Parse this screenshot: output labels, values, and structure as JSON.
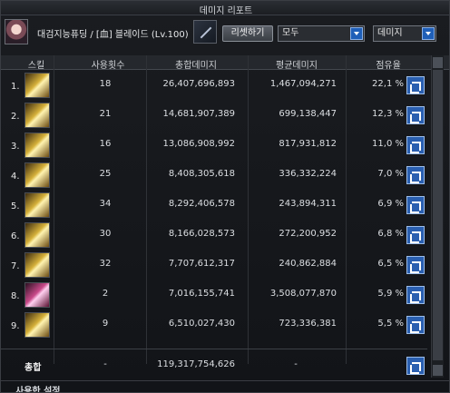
{
  "window": {
    "title": "데미지 리포트"
  },
  "header": {
    "character": "대검지능퓨딩 / [血] 블레이드 (Lv.100)",
    "reset_label": "리셋하기",
    "filter_select": "모두",
    "metric_select": "데미지"
  },
  "table": {
    "columns": [
      "스킬",
      "사용횟수",
      "총합데미지",
      "평균데미지",
      "점유율"
    ],
    "rows": [
      {
        "rank": "1.",
        "uses": "18",
        "total": "26,407,696,893",
        "avg": "1,467,094,271",
        "share": "22,1 %"
      },
      {
        "rank": "2.",
        "uses": "21",
        "total": "14,681,907,389",
        "avg": "699,138,447",
        "share": "12,3 %"
      },
      {
        "rank": "3.",
        "uses": "16",
        "total": "13,086,908,992",
        "avg": "817,931,812",
        "share": "11,0 %"
      },
      {
        "rank": "4.",
        "uses": "25",
        "total": "8,408,305,618",
        "avg": "336,332,224",
        "share": "7,0 %"
      },
      {
        "rank": "5.",
        "uses": "34",
        "total": "8,292,406,578",
        "avg": "243,894,311",
        "share": "6,9 %"
      },
      {
        "rank": "6.",
        "uses": "30",
        "total": "8,166,028,573",
        "avg": "272,200,952",
        "share": "6,8 %"
      },
      {
        "rank": "7.",
        "uses": "32",
        "total": "7,707,612,317",
        "avg": "240,862,884",
        "share": "6,5 %"
      },
      {
        "rank": "8.",
        "uses": "2",
        "total": "7,016,155,741",
        "avg": "3,508,077,870",
        "share": "5,9 %"
      },
      {
        "rank": "9.",
        "uses": "9",
        "total": "6,510,027,430",
        "avg": "723,336,381",
        "share": "5,5 %"
      }
    ],
    "total": {
      "label": "총합",
      "uses": "-",
      "total": "119,317,754,626",
      "avg": "-"
    }
  },
  "footer": {
    "title": "사용한 설정"
  }
}
